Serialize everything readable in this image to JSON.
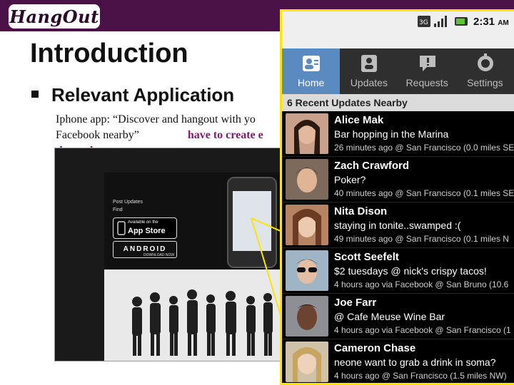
{
  "logo": {
    "text": "HangOut"
  },
  "slide": {
    "title": "Introduction",
    "bullet": "Relevant Application",
    "body_line1": "Iphone app: “Discover and hangout with yo",
    "body_line2_start": "Facebook nearby”",
    "body_line2_highlight": "have to create e",
    "body_line3_highlight": "themselves"
  },
  "website": {
    "post_updates": "Post Updates",
    "find": "Find",
    "appstore_small": "Available on the",
    "appstore_big": "App Store",
    "android": "ANDROID",
    "download": "DOWNLOAD NOW"
  },
  "phone": {
    "time": "2:31",
    "ampm": "AM",
    "network": "3G",
    "tabs": [
      {
        "label": "Home",
        "icon": "home-contacts-icon",
        "active": true
      },
      {
        "label": "Updates",
        "icon": "updates-icon",
        "active": false
      },
      {
        "label": "Requests",
        "icon": "requests-icon",
        "active": false
      },
      {
        "label": "Settings",
        "icon": "settings-icon",
        "active": false
      }
    ],
    "section_header": "6 Recent Updates Nearby",
    "updates": [
      {
        "name": "Alice Mak",
        "message": "Bar hopping in the Marina",
        "meta": "26 minutes ago @ San Francisco (0.0 miles SE"
      },
      {
        "name": "Zach Crawford",
        "message": "Poker?",
        "meta": "40 minutes ago @ San Francisco (0.1 miles SE"
      },
      {
        "name": "Nita Dison",
        "message": "staying in tonite..swamped :(",
        "meta": "49 minutes ago @ San Francisco (0.1 miles N"
      },
      {
        "name": "Scott Seefelt",
        "message": "$2 tuesdays @ nick's crispy tacos!",
        "meta": "4 hours ago via Facebook @ San Bruno (10.6"
      },
      {
        "name": "Joe Farr",
        "message": "@ Cafe Meuse Wine Bar",
        "meta": "4 hours ago via Facebook @ San Francisco (1"
      },
      {
        "name": "Cameron Chase",
        "message": "neone want to grab a drink in soma?",
        "meta": "4 hours ago @ San Francisco (1.5 miles NW)"
      }
    ]
  },
  "colors": {
    "header_bar": "#4b1248",
    "highlight_text": "#7a1f6a",
    "phone_border": "#ffe400",
    "active_tab": "#5b8ac0"
  }
}
